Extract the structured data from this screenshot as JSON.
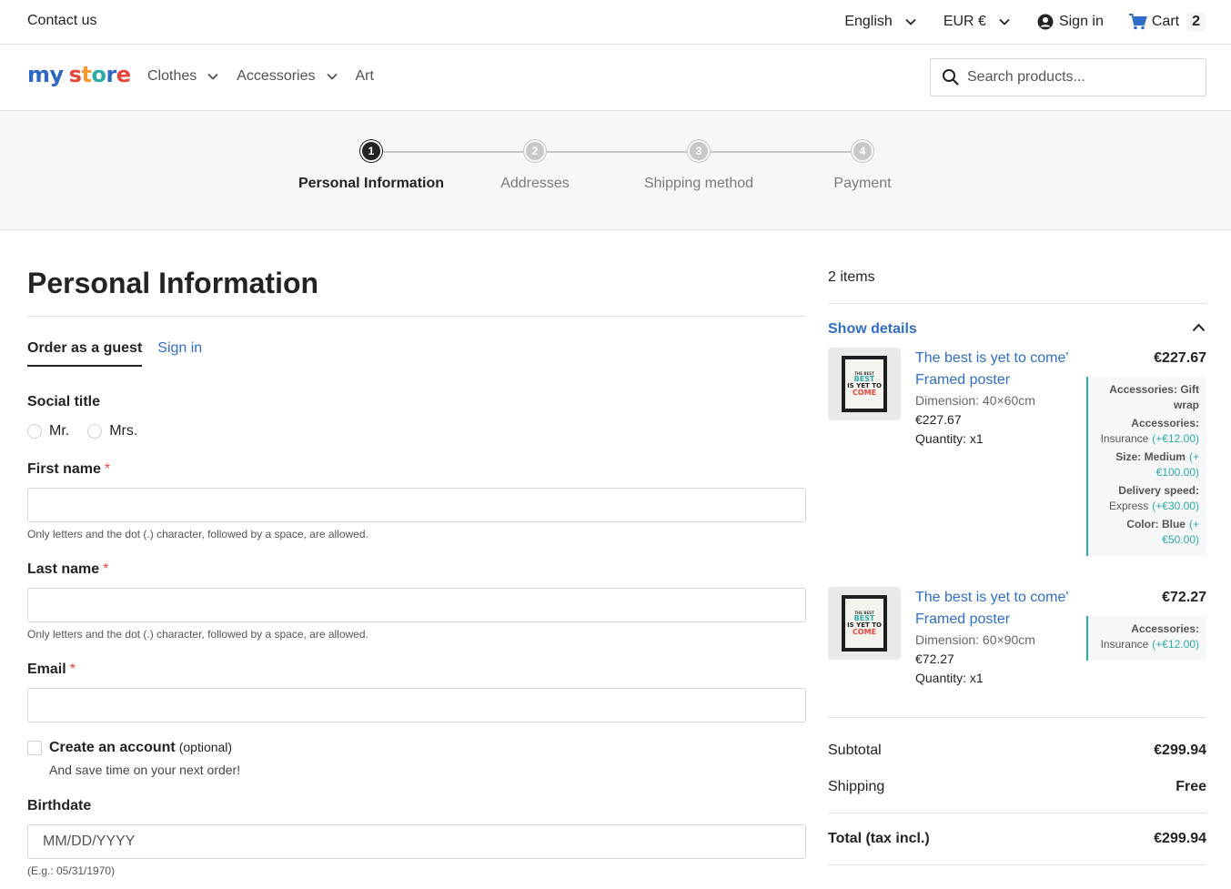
{
  "topbar": {
    "contact": "Contact us",
    "language": "English",
    "currency": "EUR €",
    "sign_in": "Sign in",
    "cart_label": "Cart",
    "cart_count": "2"
  },
  "header": {
    "logo": {
      "part1": "my",
      "part2": "store"
    },
    "nav": [
      "Clothes",
      "Accessories",
      "Art"
    ],
    "search_placeholder": "Search products..."
  },
  "steps": [
    {
      "number": "1",
      "label": "Personal Information",
      "active": true
    },
    {
      "number": "2",
      "label": "Addresses",
      "active": false
    },
    {
      "number": "3",
      "label": "Shipping method",
      "active": false
    },
    {
      "number": "4",
      "label": "Payment",
      "active": false
    }
  ],
  "form": {
    "title": "Personal Information",
    "tab_guest": "Order as a guest",
    "tab_signin": "Sign in",
    "social_title_label": "Social title",
    "social_options": [
      "Mr.",
      "Mrs."
    ],
    "first_name_label": "First name",
    "first_name_hint": "Only letters and the dot (.) character, followed by a space, are allowed.",
    "last_name_label": "Last name",
    "last_name_hint": "Only letters and the dot (.) character, followed by a space, are allowed.",
    "email_label": "Email",
    "required_mark": "*",
    "create_account_label": "Create an account",
    "create_account_optional": "(optional)",
    "create_account_sub": "And save time on your next order!",
    "birthdate_label": "Birthdate",
    "birthdate_placeholder": "MM/DD/YYYY",
    "birthdate_hint": "(E.g.: 05/31/1970)"
  },
  "summary": {
    "items_count": "2 items",
    "show_details": "Show details",
    "products": [
      {
        "name": "The best is yet to come' Framed poster",
        "dimension": "Dimension: 40×60cm",
        "unit_price": "€227.67",
        "quantity": "Quantity: x1",
        "total": "€227.67",
        "customizations": [
          {
            "key": "Accessories:",
            "value": "Gift wrap",
            "price": ""
          },
          {
            "key": "Accessories:",
            "value": "Insurance",
            "price": "(+€12.00)"
          },
          {
            "key": "Size:",
            "value": "Medium",
            "price": "(+€100.00)"
          },
          {
            "key": "Delivery speed:",
            "value": "Express",
            "price": "(+€30.00)"
          },
          {
            "key": "Color:",
            "value": "Blue",
            "price": "(+€50.00)"
          }
        ]
      },
      {
        "name": "The best is yet to come' Framed poster",
        "dimension": "Dimension: 60×90cm",
        "unit_price": "€72.27",
        "quantity": "Quantity: x1",
        "total": "€72.27",
        "customizations": [
          {
            "key": "Accessories:",
            "value": "Insurance",
            "price": "(+€12.00)"
          }
        ]
      }
    ],
    "poster_text": {
      "line1": "THE BEST",
      "line2": "BEST",
      "line3": "IS YET TO",
      "line4": "COME"
    },
    "subtotal_label": "Subtotal",
    "subtotal_value": "€299.94",
    "shipping_label": "Shipping",
    "shipping_value": "Free",
    "total_label": "Total (tax incl.)",
    "total_value": "€299.94"
  },
  "colors": {
    "accent_blue": "#2f6ec7",
    "teal": "#2eaaa5",
    "required_red": "#e6453a"
  }
}
